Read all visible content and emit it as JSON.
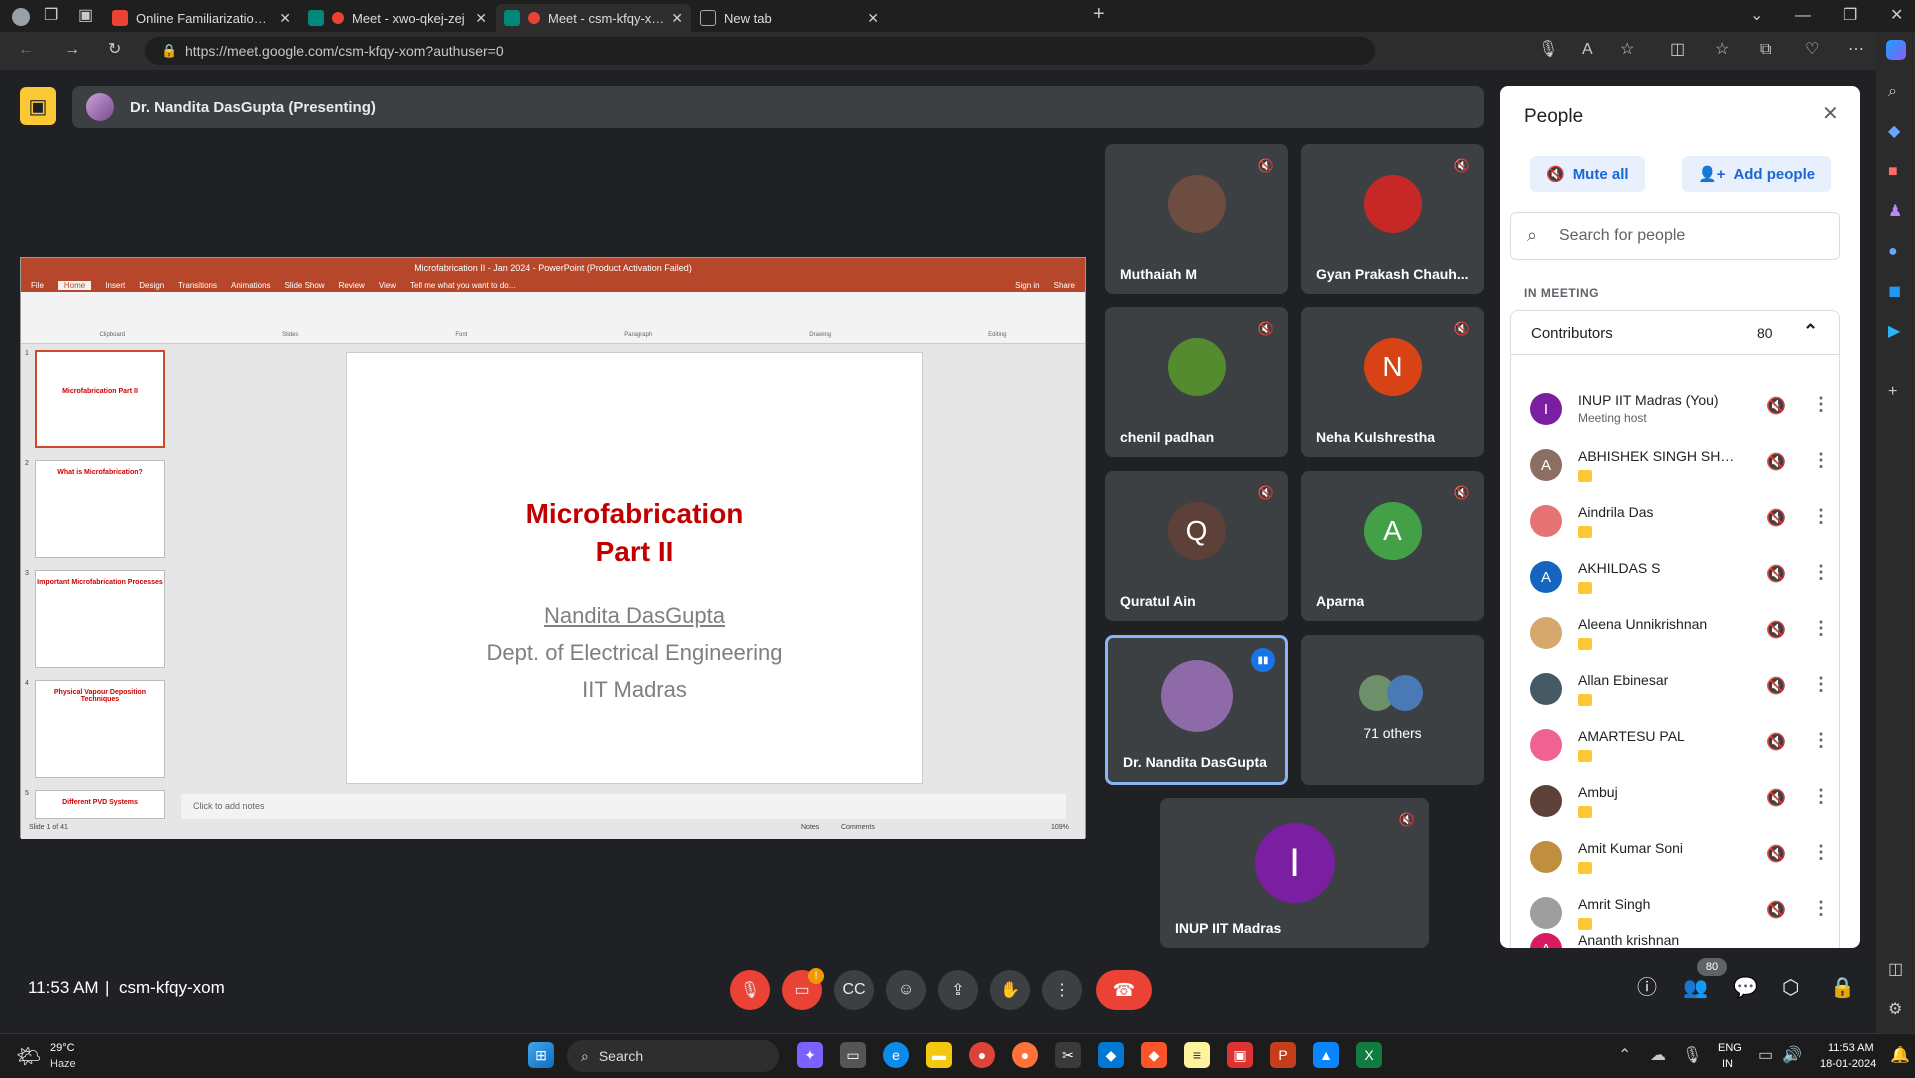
{
  "browser": {
    "tabs": [
      {
        "title": "Online Familiarization Workshop",
        "fav_color": "#ea4335"
      },
      {
        "title": "Meet - xwo-qkej-zej",
        "fav_color": "#00897b"
      },
      {
        "title": "Meet - csm-kfqy-xom",
        "fav_color": "#00897b"
      },
      {
        "title": "New tab",
        "fav_color": "#888888"
      }
    ],
    "url": "https://meet.google.com/csm-kfqy-xom?authuser=0"
  },
  "presenter_bar": {
    "label": "Dr. Nandita DasGupta (Presenting)"
  },
  "powerpoint": {
    "window_title": "Microfabrication II - Jan 2024 - PowerPoint (Product Activation Failed)",
    "menu": [
      "File",
      "Home",
      "Insert",
      "Design",
      "Transitions",
      "Animations",
      "Slide Show",
      "Review",
      "View"
    ],
    "tell_me": "Tell me what you want to do...",
    "signin": "Sign in",
    "share": "Share",
    "ribbon_groups": [
      "Clipboard",
      "Slides",
      "Font",
      "Paragraph",
      "Drawing",
      "Editing"
    ],
    "thumbnails": [
      {
        "num": "1",
        "title": "Microfabrication Part II"
      },
      {
        "num": "2",
        "title": "What is Microfabrication?"
      },
      {
        "num": "3",
        "title": "Important Microfabrication Processes"
      },
      {
        "num": "4",
        "title": "Physical Vapour Deposition Techniques"
      },
      {
        "num": "5",
        "title": "Different PVD Systems"
      }
    ],
    "slide": {
      "title_line1": "Microfabrication",
      "title_line2": "Part II",
      "author": "Nandita DasGupta",
      "dept": "Dept. of Electrical Engineering",
      "inst": "IIT Madras"
    },
    "notes_placeholder": "Click to add notes",
    "status_left": "Slide 1 of 41",
    "status_notes": "Notes",
    "status_comments": "Comments",
    "zoom": "109%"
  },
  "tiles": [
    {
      "name": "Muthaiah M",
      "avatar": "",
      "color": "#6d4c41"
    },
    {
      "name": "Gyan Prakash Chauh...",
      "avatar": "",
      "color": "#c62828"
    },
    {
      "name": "chenil padhan",
      "avatar": "",
      "color": "#558b2f"
    },
    {
      "name": "Neha Kulshrestha",
      "avatar": "N",
      "color": "#d84315"
    },
    {
      "name": "Quratul Ain",
      "avatar": "Q",
      "color": "#5d4037"
    },
    {
      "name": "Aparna",
      "avatar": "A",
      "color": "#43a047"
    },
    {
      "name": "Dr. Nandita DasGupta",
      "avatar": "",
      "color": "#8e6aa8"
    },
    {
      "name": "71 others",
      "avatar": "",
      "color": "#3c4043"
    },
    {
      "name": "INUP IIT Madras",
      "avatar": "I",
      "color": "#7b1fa2"
    }
  ],
  "people": {
    "title": "People",
    "mute_all": "Mute all",
    "add_people": "Add people",
    "search_placeholder": "Search for people",
    "in_meeting": "IN MEETING",
    "contributors_label": "Contributors",
    "contributors_count": "80",
    "list": [
      {
        "name": "INUP IIT Madras (You)",
        "sub": "Meeting host",
        "initial": "I",
        "color": "#7b1fa2"
      },
      {
        "name": "ABHISHEK SINGH SHEK...",
        "sub": "",
        "initial": "A",
        "color": "#8d6e63"
      },
      {
        "name": "Aindrila Das",
        "sub": "",
        "initial": "",
        "color": "#e57373"
      },
      {
        "name": "AKHILDAS S",
        "sub": "",
        "initial": "A",
        "color": "#1565c0"
      },
      {
        "name": "Aleena Unnikrishnan",
        "sub": "",
        "initial": "",
        "color": "#d7a86e"
      },
      {
        "name": "Allan Ebinesar",
        "sub": "",
        "initial": "",
        "color": "#455a64"
      },
      {
        "name": "AMARTESU PAL",
        "sub": "",
        "initial": "",
        "color": "#f06292"
      },
      {
        "name": "Ambuj",
        "sub": "",
        "initial": "",
        "color": "#5d4037"
      },
      {
        "name": "Amit Kumar Soni",
        "sub": "",
        "initial": "",
        "color": "#bf8f3f"
      },
      {
        "name": "Amrit Singh",
        "sub": "",
        "initial": "",
        "color": "#9e9e9e"
      },
      {
        "name": "Ananth krishnan",
        "sub": "",
        "initial": "A",
        "color": "#d81b60"
      }
    ]
  },
  "meeting_info": {
    "time": "11:53 AM",
    "code": "csm-kfqy-xom",
    "people_badge": "80"
  },
  "taskbar": {
    "weather_temp": "29°C",
    "weather_desc": "Haze",
    "search": "Search",
    "lang1": "ENG",
    "lang2": "IN",
    "time": "11:53 AM",
    "date": "18-01-2024"
  }
}
